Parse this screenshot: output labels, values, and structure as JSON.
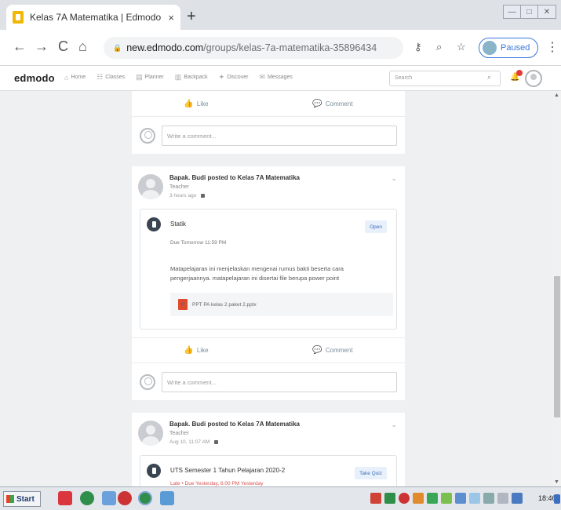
{
  "browser": {
    "tab_title": "Kelas 7A Matematika | Edmodo",
    "tab_close": "×",
    "new_tab": "+",
    "url_host": "new.edmodo.com",
    "url_path": "/groups/kelas-7a-matematika-35896434",
    "profile_label": "Paused",
    "nav_back": "←",
    "nav_forward": "→",
    "nav_reload": "C",
    "nav_home": "⌂",
    "icon_lock": "🔒",
    "icon_key": "⚷",
    "icon_zoom": "⌕",
    "icon_star": "☆",
    "menu": "⋮",
    "win_min": "—",
    "win_max": "□",
    "win_close": "✕"
  },
  "edmodo": {
    "logo": "edmodo",
    "nav": [
      {
        "icon": "⌂",
        "label": "Home"
      },
      {
        "icon": "☷",
        "label": "Classes"
      },
      {
        "icon": "▤",
        "label": "Planner"
      },
      {
        "icon": "▥",
        "label": "Backpack"
      },
      {
        "icon": "✦",
        "label": "Discover"
      },
      {
        "icon": "✉",
        "label": "Messages"
      }
    ],
    "search_placeholder": "Search",
    "search_icon": "⌕",
    "bell_icon": "🔔"
  },
  "feed": {
    "like_label": "Like",
    "comment_label": "Comment",
    "like_icon": "👍",
    "comment_icon": "💬",
    "comment_placeholder": "Write a comment...",
    "more_icon": "⌄",
    "posts": [
      {
        "author": "Bapak. Budi posted to Kelas 7A Matematika",
        "role": "Teacher",
        "time": "3 hours ago",
        "assignment": {
          "title": "Statik",
          "button": "Open",
          "due": "Due Tomorrow 11:59 PM",
          "description": "Matapelajaran ini menjelaskan mengenai rumus bakti beserta cara pengerjaannya. matapelajaran ini disertai file berupa power point",
          "file_name": "PPT PA kelas 2 paket 2.pptx",
          "file_icon": "P"
        }
      },
      {
        "author": "Bapak. Budi posted to Kelas 7A Matematika",
        "role": "Teacher",
        "time": "Aug 10, 11:07 AM",
        "assignment": {
          "title": "UTS Semester 1 Tahun Pelajaran 2020-2",
          "button": "Take Quiz",
          "due": "Late • Due Yesterday, 6:00 PM Yesterday"
        }
      }
    ]
  },
  "taskbar": {
    "start_label": "Start",
    "clock": "18:46"
  }
}
